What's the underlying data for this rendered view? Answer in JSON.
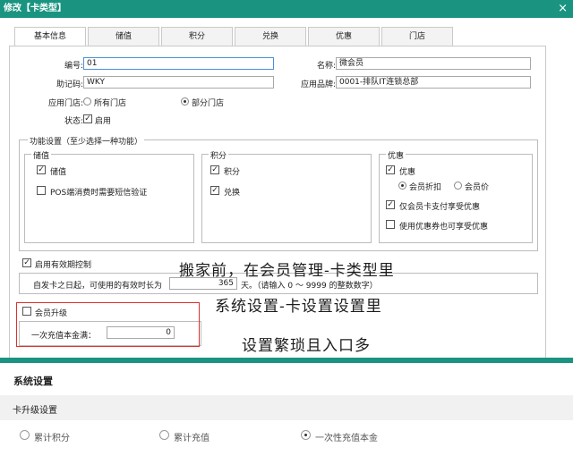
{
  "dialog": {
    "title": "修改【卡类型】",
    "close": "×"
  },
  "tabs": [
    "基本信息",
    "储值",
    "积分",
    "兑换",
    "优惠",
    "门店"
  ],
  "form": {
    "code_label": "编号:",
    "code_value": "01",
    "name_label": "名称:",
    "name_value": "微会员",
    "mnemonic_label": "助记码:",
    "mnemonic_value": "WKY",
    "brand_label": "应用品牌:",
    "brand_value": "0001-排队IT连锁总部",
    "stores_label": "应用门店:",
    "stores_all": "所有门店",
    "stores_partial": "部分门店",
    "status_label": "状态:",
    "status_enabled": "启用"
  },
  "features": {
    "legend": "功能设置（至少选择一种功能）",
    "stored_value": {
      "legend": "储值",
      "opt1": "储值",
      "opt2": "POS端消费时需要短信验证"
    },
    "points": {
      "legend": "积分",
      "opt1": "积分",
      "opt2": "兑换"
    },
    "discount": {
      "legend": "优惠",
      "opt1": "优惠",
      "member_discount": "会员折扣",
      "member_price": "会员价",
      "opt_card_only": "仅会员卡支付享受优惠",
      "opt_coupon": "使用优惠券也可享受优惠"
    }
  },
  "validity": {
    "label": "启用有效期控制",
    "desc": "自发卡之日起，可使用的有效时长为",
    "value": "365",
    "unit": "天。（请输入 0 ～ 9999 的整数数字）"
  },
  "upgrade": {
    "label": "会员升级",
    "amount_label": "一次充值本金满：",
    "amount_value": "0"
  },
  "annotations": {
    "line1": "搬家前，在会员管理-卡类型里",
    "line2": "系统设置-卡设置设置里",
    "line3": "设置繁琐且入口多"
  },
  "system": {
    "title": "系统设置",
    "subtitle": "卡升级设置",
    "options": [
      "累计积分",
      "累计充值",
      "一次性充值本金"
    ]
  }
}
